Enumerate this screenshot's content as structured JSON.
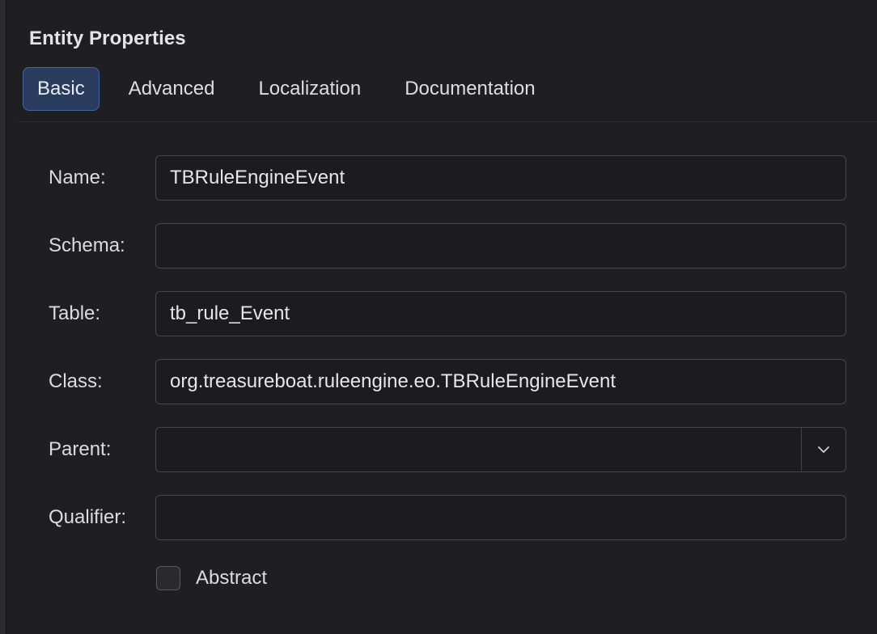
{
  "panel": {
    "title": "Entity Properties"
  },
  "tabs": [
    {
      "label": "Basic",
      "active": true
    },
    {
      "label": "Advanced",
      "active": false
    },
    {
      "label": "Localization",
      "active": false
    },
    {
      "label": "Documentation",
      "active": false
    }
  ],
  "form": {
    "name": {
      "label": "Name:",
      "value": "TBRuleEngineEvent"
    },
    "schema": {
      "label": "Schema:",
      "value": ""
    },
    "table": {
      "label": "Table:",
      "value": "tb_rule_Event"
    },
    "class": {
      "label": "Class:",
      "value": "org.treasureboat.ruleengine.eo.TBRuleEngineEvent"
    },
    "parent": {
      "label": "Parent:",
      "value": "",
      "icon": "chevron-down-icon"
    },
    "qualifier": {
      "label": "Qualifier:",
      "value": ""
    },
    "abstract": {
      "label": "Abstract",
      "checked": false
    }
  },
  "colors": {
    "background": "#1f1f21",
    "active_tab_bg": "#2a3c5e",
    "active_tab_border": "#4466a0",
    "input_border": "#47474b"
  }
}
